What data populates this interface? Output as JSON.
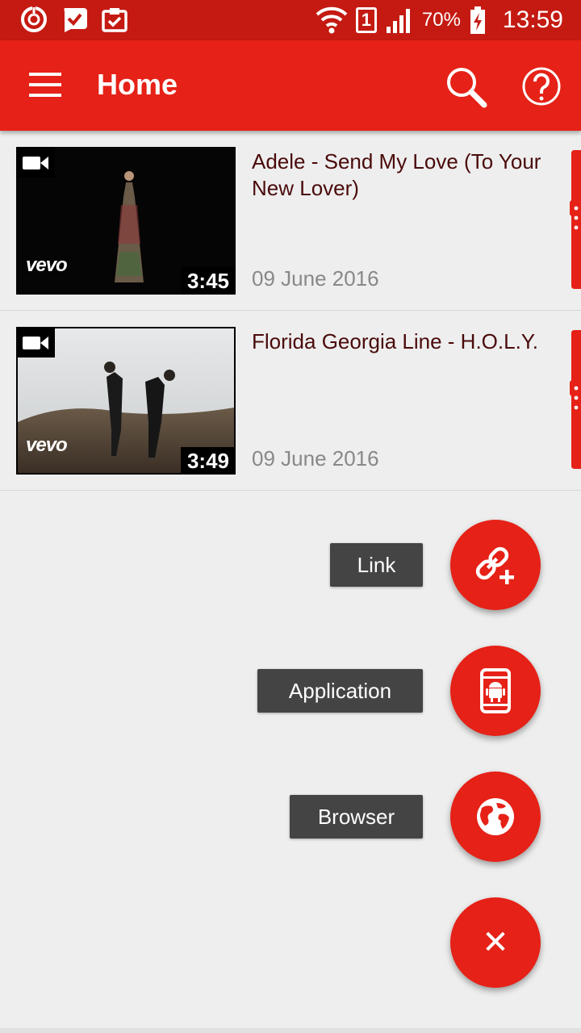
{
  "status_bar": {
    "battery_percent": "70%",
    "time": "13:59",
    "sim_slot": "1",
    "icons": [
      "power-saver-icon",
      "chat-check-icon",
      "clipboard-check-icon",
      "wifi-icon",
      "signal-icon",
      "battery-charging-icon"
    ]
  },
  "app_bar": {
    "title": "Home",
    "icons": [
      "menu-icon",
      "search-icon",
      "help-icon"
    ]
  },
  "videos": [
    {
      "title": "Adele - Send My Love (To Your New Lover)",
      "date": "09 June 2016",
      "duration": "3:45",
      "watermark": "vevo"
    },
    {
      "title": "Florida Georgia Line - H.O.L.Y.",
      "date": "09 June 2016",
      "duration": "3:49",
      "watermark": "vevo"
    }
  ],
  "fab_menu": {
    "link_label": "Link",
    "application_label": "Application",
    "browser_label": "Browser",
    "close_glyph": "✕"
  },
  "colors": {
    "status_bar": "#c41a12",
    "app_bar": "#e62117",
    "fab": "#e62117",
    "title_text": "#4a0a0a",
    "date_text": "#888888",
    "label_bg": "#444444"
  }
}
